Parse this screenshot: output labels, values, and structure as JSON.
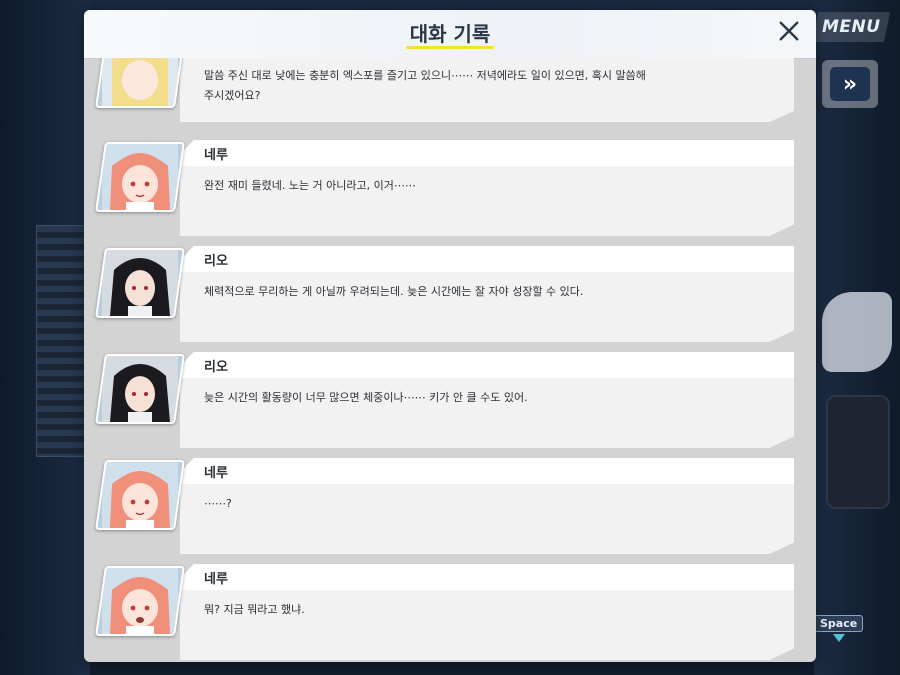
{
  "hud": {
    "menu_label": "MENU",
    "fast_forward_symbol": "»",
    "space_key_label": "Space"
  },
  "history_panel": {
    "title": "대화 기록",
    "entries": [
      {
        "speaker": "",
        "text": "말씀 주신 대로 낮에는 충분히 엑스포를 즐기고 있으니⋯⋯ 저녁에라도 일이 있으면, 혹시 말씀해\n주시겠어요?",
        "portrait": "blonde-girl-portrait"
      },
      {
        "speaker": "네루",
        "text": "완전 재미 들렸네. 노는 거 아니라고, 이거⋯⋯",
        "portrait": "neru-portrait"
      },
      {
        "speaker": "리오",
        "text": "체력적으로 무리하는 게 아닐까 우려되는데. 늦은 시간에는 잘 자야 성장할 수 있다.",
        "portrait": "rio-portrait"
      },
      {
        "speaker": "리오",
        "text": "늦은 시간의 활동량이 너무 많으면 체중이나⋯⋯ 키가 안 클 수도 있어.",
        "portrait": "rio-portrait"
      },
      {
        "speaker": "네루",
        "text": "⋯⋯?",
        "portrait": "neru-portrait"
      },
      {
        "speaker": "네루",
        "text": "뭐? 지금 뭐라고 했냐.",
        "portrait": "neru-portrait"
      }
    ]
  },
  "colors": {
    "title_underline": "#f3df3a",
    "panel_bg": "#d2d3d2",
    "bubble_bg": "#f2f2f2",
    "neru_hair": "#f0907a",
    "rio_hair": "#1a1a1f",
    "blonde_hair": "#f3dc8a"
  }
}
